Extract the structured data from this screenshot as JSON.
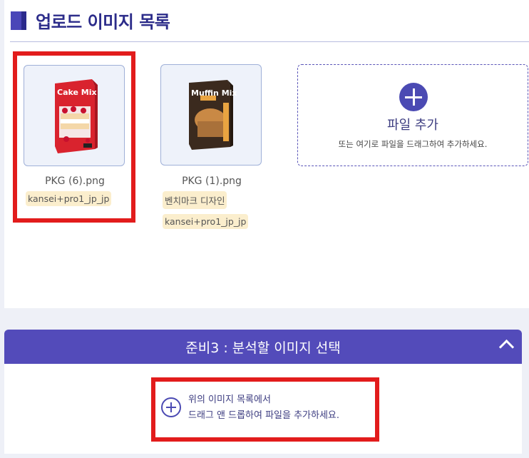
{
  "header": {
    "title": "업로드 이미지 목록"
  },
  "images": [
    {
      "filename": "PKG (6).png",
      "product_label": "Cake Mix",
      "tags": [
        "kansei+pro1_jp_jp"
      ],
      "selected": true
    },
    {
      "filename": "PKG (1).png",
      "product_label": "Muffin Mix",
      "tags": [
        "벤치마크 디자인",
        "kansei+pro1_jp_jp"
      ],
      "selected": false
    }
  ],
  "upload": {
    "label": "파일 추가",
    "hint": "또는 여기로 파일을 드래그하여 추가하세요."
  },
  "section3": {
    "title": "준비3 : 분석할 이미지 선택",
    "hint_line1": "위의 이미지 목록에서",
    "hint_line2": "드래그 앤 드롭하여 파일을 추가하세요."
  },
  "colors": {
    "accent": "#534bba",
    "title": "#2c2c8a",
    "highlight": "#e21c1c",
    "tag_bg": "#fbeecd"
  }
}
